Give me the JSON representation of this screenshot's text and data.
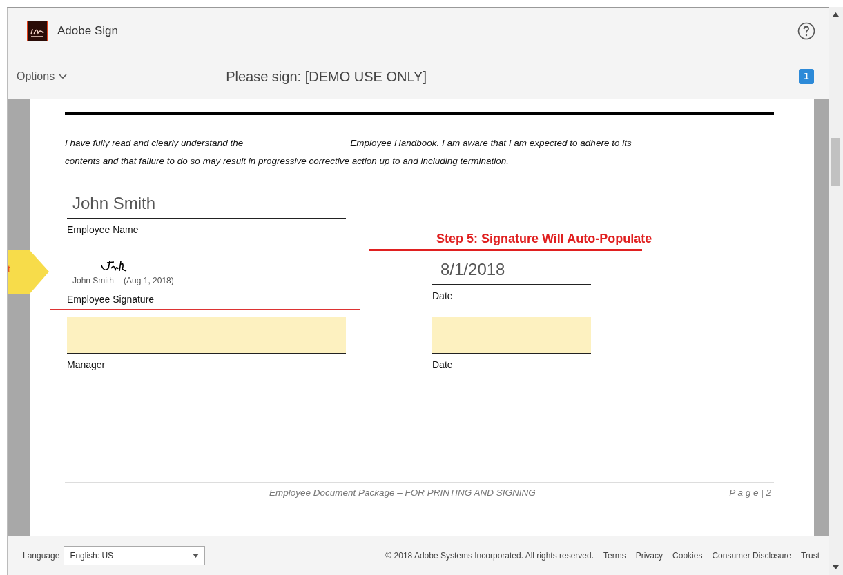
{
  "app": {
    "title": "Adobe Sign"
  },
  "toolbar": {
    "options_label": "Options",
    "document_title": "Please sign: [DEMO USE ONLY]",
    "badge": "1"
  },
  "document": {
    "paragraph_part_1": "I have fully read and clearly understand the",
    "paragraph_part_2": "Employee Handbook.  I am aware that I am expected to adhere to its",
    "paragraph_line_2": "contents and that failure to do so may result in progressive corrective action up to and including termination.",
    "rows": [
      {
        "cells": [
          {
            "kind": "text",
            "value": "John Smith",
            "label": "Employee Name"
          }
        ]
      },
      {
        "cells": [
          {
            "kind": "signature",
            "signer": "John Smith",
            "date": "(Aug 1, 2018)",
            "label": "Employee Signature"
          },
          {
            "kind": "text",
            "value": "8/1/2018",
            "label": "Date"
          }
        ]
      },
      {
        "cells": [
          {
            "kind": "empty",
            "label": "Manager"
          },
          {
            "kind": "empty",
            "label": "Date"
          }
        ]
      }
    ],
    "page_footer": {
      "text": "Employee Document Package – FOR PRINTING AND SIGNING",
      "page": "P a g e | 2"
    }
  },
  "start_tab": "t",
  "annotation": "Step 5: Signature Will Auto-Populate",
  "footer": {
    "language_label": "Language",
    "language_value": "English: US",
    "copyright": "© 2018 Adobe Systems Incorporated. All rights reserved.",
    "links": [
      "Terms",
      "Privacy",
      "Cookies",
      "Consumer Disclosure",
      "Trust"
    ]
  }
}
